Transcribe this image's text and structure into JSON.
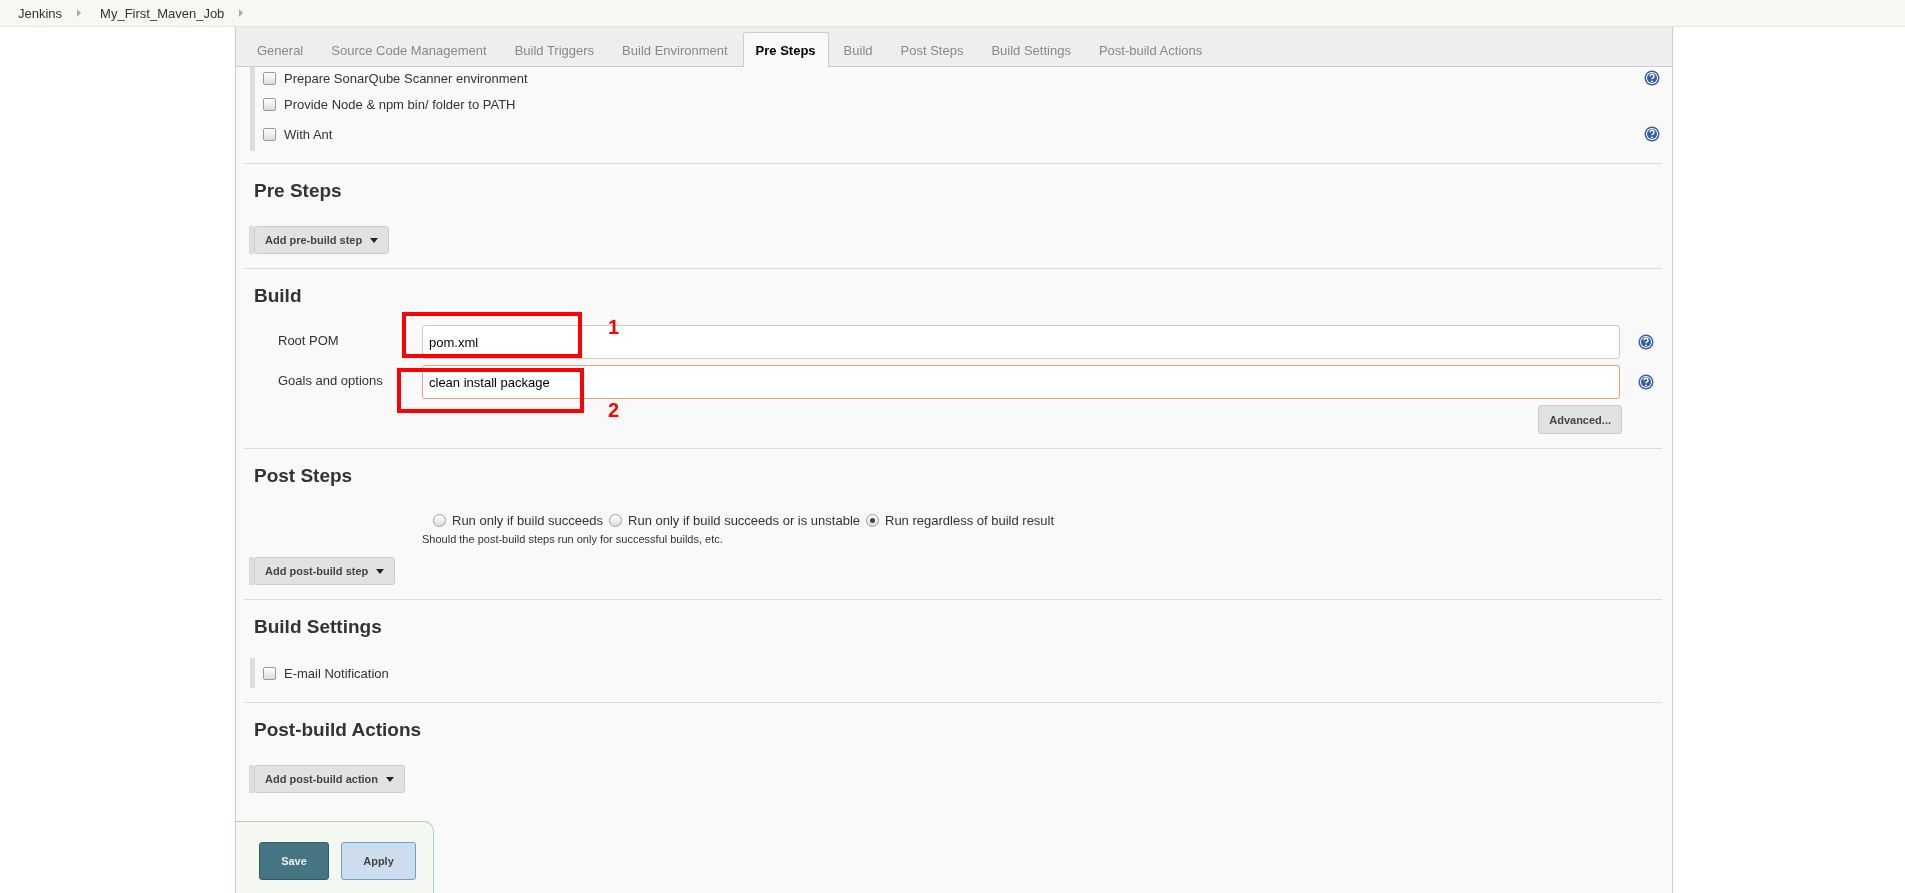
{
  "breadcrumbs": [
    {
      "label": "Jenkins"
    },
    {
      "label": "My_First_Maven_Job"
    }
  ],
  "tabs": [
    {
      "label": "General",
      "selected": false
    },
    {
      "label": "Source Code Management",
      "selected": false
    },
    {
      "label": "Build Triggers",
      "selected": false
    },
    {
      "label": "Build Environment",
      "selected": false
    },
    {
      "label": "Pre Steps",
      "selected": true
    },
    {
      "label": "Build",
      "selected": false
    },
    {
      "label": "Post Steps",
      "selected": false
    },
    {
      "label": "Build Settings",
      "selected": false
    },
    {
      "label": "Post-build Actions",
      "selected": false
    }
  ],
  "environment_options": [
    {
      "label": "Prepare SonarQube Scanner environment",
      "checked": false,
      "help": true
    },
    {
      "label": "Provide Node & npm bin/ folder to PATH",
      "checked": false,
      "help": false
    },
    {
      "label": "With Ant",
      "checked": false,
      "help": true
    }
  ],
  "sections": [
    {
      "kind": "adder",
      "title": "Pre Steps",
      "button": "Add pre-build step"
    },
    {
      "kind": "build",
      "title": "Build",
      "fields": [
        {
          "label": "Root POM",
          "value": "pom.xml",
          "invalid": false,
          "help": true
        },
        {
          "label": "Goals and options",
          "value": "clean install package",
          "invalid": true,
          "help": true
        }
      ],
      "button": "Advanced..."
    },
    {
      "kind": "post_steps",
      "title": "Post Steps",
      "options": [
        {
          "label": "Run only if build succeeds",
          "selected": false
        },
        {
          "label": "Run only if build succeeds or is unstable",
          "selected": false
        },
        {
          "label": "Run regardless of build result",
          "selected": true
        }
      ],
      "hint": "Should the post-build steps run only for successful builds, etc.",
      "button": "Add post-build step"
    },
    {
      "kind": "checkboxes",
      "title": "Build Settings",
      "options": [
        {
          "label": "E-mail Notification",
          "checked": false
        }
      ]
    },
    {
      "kind": "adder",
      "title": "Post-build Actions",
      "button": "Add post-build action"
    }
  ],
  "footer_buttons": [
    {
      "label": "Save",
      "kind": "primary"
    },
    {
      "label": "Apply",
      "kind": "secondary"
    }
  ],
  "annotations": [
    {
      "number": "1"
    },
    {
      "number": "2"
    }
  ]
}
